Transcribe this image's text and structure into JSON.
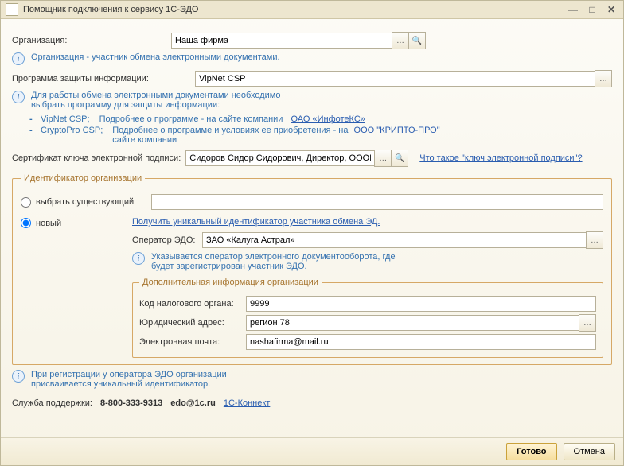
{
  "window": {
    "title": "Помощник подключения к сервису 1С-ЭДО"
  },
  "org": {
    "label": "Организация:",
    "value": "Наша фирма",
    "note": "Организация - участник обмена электронными документами."
  },
  "crypto": {
    "label": "Программа защиты информации:",
    "value": "VipNet CSP",
    "note_line1": "Для работы обмена электронными документами необходимо",
    "note_line2": "выбрать программу для защиты информации:",
    "opt1_name": "VipNet CSP;",
    "opt1_text": "Подробнее о программе - на сайте компании",
    "opt1_link": "ОАО «ИнфотеКС»",
    "opt2_name": "CryptoPro CSP;",
    "opt2_text_a": "Подробнее о программе и условиях ее приобретения - на",
    "opt2_link": "ООО \"КРИПТО-ПРО\"",
    "opt2_text_b": "сайте компании"
  },
  "cert": {
    "label": "Сертификат ключа электронной подписи:",
    "value": "Сидоров Сидор Сидорович, Директор, ОООНаша фирм",
    "help_link": "Что такое \"ключ электронной подписи\"?"
  },
  "id": {
    "legend": "Идентификатор организации",
    "radio_existing": "выбрать существующий",
    "radio_new": "новый",
    "get_link": "Получить уникальный идентификатор участника обмена ЭД.",
    "operator_label": "Оператор ЭДО:",
    "operator_value": "ЗАО «Калуга Астрал»",
    "operator_note_a": "Указывается оператор электронного документооборота, где",
    "operator_note_b": "будет зарегистрирован участник ЭДО.",
    "extra_legend": "Дополнительная информация организации",
    "tax_label": "Код налогового органа:",
    "tax_value": "9999",
    "addr_label": "Юридический адрес:",
    "addr_value": "регион 78",
    "email_label": "Электронная почта:",
    "email_value": "nashafirma@mail.ru",
    "reg_note_a": "При регистрации у оператора ЭДО организации",
    "reg_note_b": "присваивается уникальный идентификатор."
  },
  "support": {
    "label": "Служба поддержки:",
    "phone": "8-800-333-9313",
    "email": "edo@1c.ru",
    "link": "1С-Коннект"
  },
  "footer": {
    "done": "Готово",
    "cancel": "Отмена"
  }
}
